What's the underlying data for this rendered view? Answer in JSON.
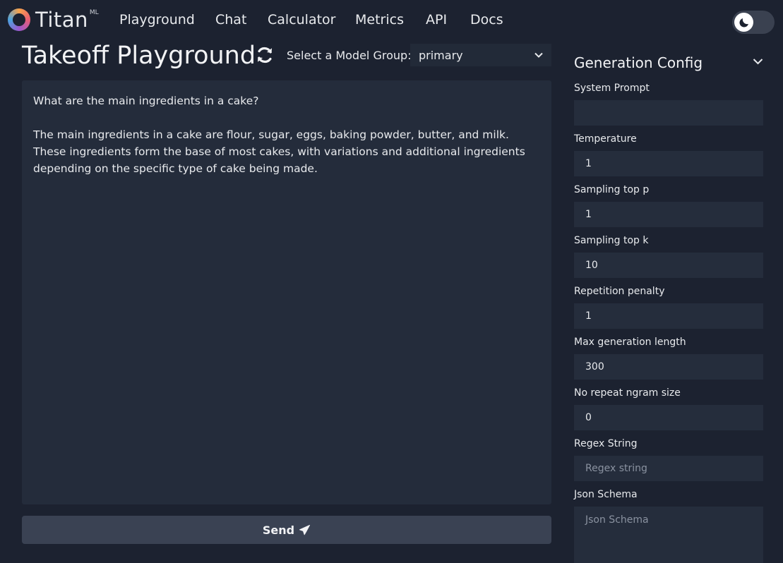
{
  "nav": {
    "logo_text": "Titan",
    "logo_sup": "ML",
    "links": [
      "Playground",
      "Chat",
      "Calculator",
      "Metrics",
      "API",
      "Docs"
    ]
  },
  "header": {
    "title": "Takeoff Playground",
    "model_group_label": "Select a Model Group:",
    "model_group_value": "primary"
  },
  "chat": {
    "prompt": "What are the main ingredients in a cake?",
    "response": "The main ingredients in a cake are flour, sugar, eggs, baking powder, butter, and milk. These ingredients form the base of most cakes, with variations and additional ingredients depending on the specific type of cake being made."
  },
  "send_label": "Send",
  "config": {
    "title": "Generation Config",
    "fields": [
      {
        "label": "System Prompt",
        "value": ""
      },
      {
        "label": "Temperature",
        "value": "1"
      },
      {
        "label": "Sampling top p",
        "value": "1"
      },
      {
        "label": "Sampling top k",
        "value": "10"
      },
      {
        "label": "Repetition penalty",
        "value": "1"
      },
      {
        "label": "Max generation length",
        "value": "300"
      },
      {
        "label": "No repeat ngram size",
        "value": "0"
      },
      {
        "label": "Regex String",
        "placeholder": "Regex string"
      },
      {
        "label": "Json Schema",
        "placeholder": "Json Schema"
      }
    ]
  },
  "colors": {
    "background": "#1c2230",
    "panel": "#242c3b",
    "button": "#3a4253"
  },
  "icons": [
    "titan-logo-icon",
    "refresh-icon",
    "chevron-down-icon",
    "send-icon",
    "moon-icon"
  ]
}
